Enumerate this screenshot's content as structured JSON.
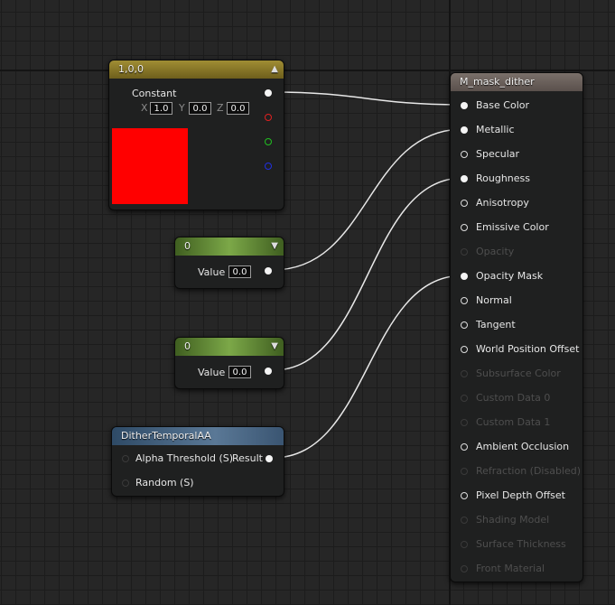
{
  "constant_node": {
    "title": "1,0,0",
    "label": "Constant",
    "x_axis": "X",
    "x_value": "1.0",
    "y_axis": "Y",
    "y_value": "0.0",
    "z_axis": "Z",
    "z_value": "0.0",
    "swatch_color": "#ff0000",
    "pin_colors": [
      "#f4f4f4",
      "#e02020",
      "#20c020",
      "#2030e0"
    ]
  },
  "scalar_nodes": [
    {
      "title": "0",
      "value_label": "Value",
      "value": "0.0"
    },
    {
      "title": "0",
      "value_label": "Value",
      "value": "0.0"
    }
  ],
  "dither_node": {
    "title": "DitherTemporalAA",
    "inputs": [
      "Alpha Threshold (S)",
      "Random (S)"
    ],
    "output": "Result"
  },
  "material_node": {
    "title": "M_mask_dither",
    "pins": [
      {
        "label": "Base Color",
        "state": "connected"
      },
      {
        "label": "Metallic",
        "state": "connected"
      },
      {
        "label": "Specular",
        "state": "open"
      },
      {
        "label": "Roughness",
        "state": "connected"
      },
      {
        "label": "Anisotropy",
        "state": "open"
      },
      {
        "label": "Emissive Color",
        "state": "open"
      },
      {
        "label": "Opacity",
        "state": "disabled"
      },
      {
        "label": "Opacity Mask",
        "state": "connected"
      },
      {
        "label": "Normal",
        "state": "open"
      },
      {
        "label": "Tangent",
        "state": "open"
      },
      {
        "label": "World Position Offset",
        "state": "open"
      },
      {
        "label": "Subsurface Color",
        "state": "disabled"
      },
      {
        "label": "Custom Data 0",
        "state": "disabled"
      },
      {
        "label": "Custom Data 1",
        "state": "disabled"
      },
      {
        "label": "Ambient Occlusion",
        "state": "open"
      },
      {
        "label": "Refraction (Disabled)",
        "state": "disabled"
      },
      {
        "label": "Pixel Depth Offset",
        "state": "open"
      },
      {
        "label": "Shading Model",
        "state": "disabled"
      },
      {
        "label": "Surface Thickness",
        "state": "disabled"
      },
      {
        "label": "Front Material",
        "state": "disabled"
      }
    ]
  },
  "colors": {
    "constant_header": "#8c7a28",
    "scalar_header": "#5f8430",
    "dither_header": "#3e5a78",
    "material_header": "#6a605a",
    "wire": "#e8e8e8"
  }
}
